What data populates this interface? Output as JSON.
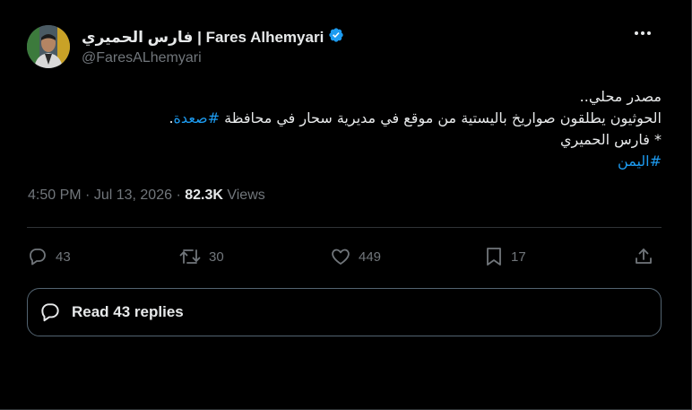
{
  "author": {
    "display_name": "فارس الحميري | Fares Alhemyari",
    "handle": "@FaresALhemyari",
    "verified_icon": "verified-badge-icon",
    "avatar_icon": "avatar-photo"
  },
  "tweet": {
    "line1": "مصدر محلي..",
    "line2_text": "الحوثيون يطلقون صواريخ باليستية من موقع في مديرية سحار في محافظة ",
    "line2_hashtag": "#صعدة",
    "line2_end": ".",
    "line3": "* فارس الحميري",
    "line4_hashtag": "#اليمن"
  },
  "meta": {
    "time": "4:50 PM",
    "sep1": " · ",
    "date": "Jul 13, 2026",
    "sep2": " · ",
    "views_count": "82.3K",
    "views_label": " Views"
  },
  "actions": {
    "replies": "43",
    "reposts": "30",
    "likes": "449",
    "bookmarks": "17"
  },
  "read_replies": {
    "label": "Read 43 replies"
  },
  "colors": {
    "accent": "#1d9bf0",
    "secondary_text": "#71767b",
    "border": "#2f3336"
  }
}
